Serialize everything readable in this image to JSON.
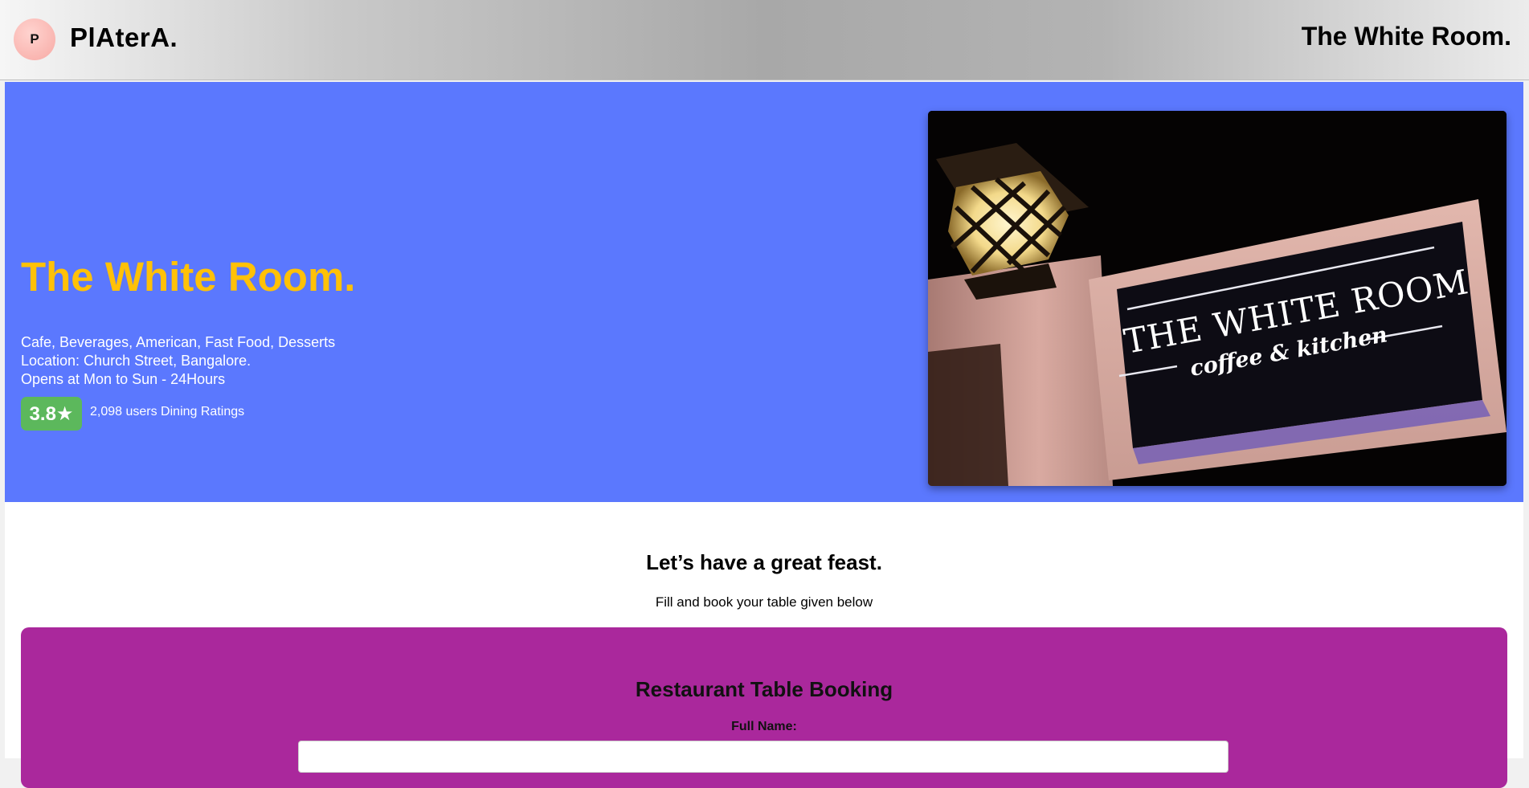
{
  "header": {
    "logo_letter": "P",
    "brand": "PlAterA.",
    "title": "The White Room."
  },
  "hero": {
    "title": "The White Room.",
    "cuisines": "Cafe, Beverages, American, Fast Food, Desserts",
    "location": "Location: Church Street, Bangalore.",
    "hours": "Opens at Mon to Sun - 24Hours",
    "rating": "3.8★",
    "rating_text": "2,098 users Dining Ratings",
    "image": {
      "sign_title": "THE WHITE ROOM",
      "sign_subtitle": "coffee & kitchen"
    }
  },
  "booking": {
    "heading": "Let’s have a great feast.",
    "subheading": "Fill and book your table given below",
    "form_title": "Restaurant Table Booking",
    "full_name_label": "Full Name:",
    "full_name_value": "",
    "full_name_placeholder": ""
  },
  "colors": {
    "hero_bg": "#5b78fe",
    "hero_title": "#ffc107",
    "rating_bg": "#5cb85c",
    "booking_card_bg": "#aa289c"
  }
}
